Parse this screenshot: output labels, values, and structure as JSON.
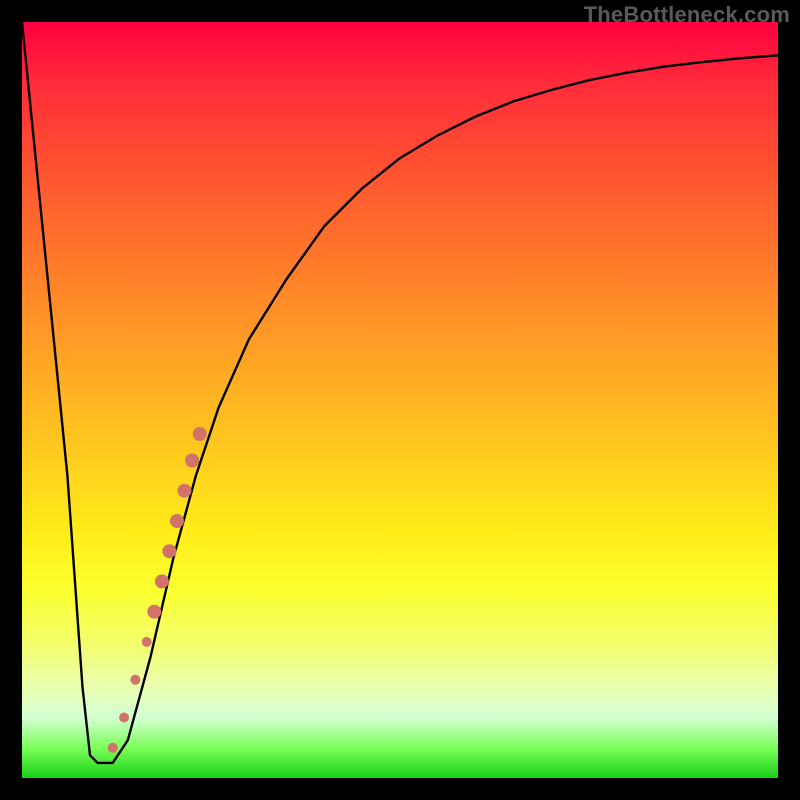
{
  "watermark": "TheBottleneck.com",
  "colors": {
    "frame": "#000000",
    "curve": "#000000",
    "marker": "#d27369",
    "watermark": "#5a5a5a"
  },
  "chart_data": {
    "type": "line",
    "title": "",
    "xlabel": "",
    "ylabel": "",
    "xlim": [
      0,
      100
    ],
    "ylim": [
      0,
      100
    ],
    "grid": false,
    "series": [
      {
        "name": "bottleneck-curve",
        "x": [
          0,
          3,
          6,
          8,
          9,
          10,
          12,
          14,
          17,
          20,
          23,
          26,
          30,
          35,
          40,
          45,
          50,
          55,
          60,
          65,
          70,
          75,
          80,
          85,
          90,
          95,
          100
        ],
        "y": [
          100,
          70,
          40,
          12,
          3,
          2,
          2,
          5,
          16,
          29,
          40,
          49,
          58,
          66,
          73,
          78,
          82,
          85,
          87.5,
          89.5,
          91,
          92.3,
          93.3,
          94.1,
          94.7,
          95.2,
          95.6
        ]
      }
    ],
    "markers": [
      {
        "x": 12.0,
        "y": 4.0,
        "r": 5
      },
      {
        "x": 13.5,
        "y": 8.0,
        "r": 5
      },
      {
        "x": 15.0,
        "y": 13.0,
        "r": 5
      },
      {
        "x": 16.5,
        "y": 18.0,
        "r": 5
      },
      {
        "x": 17.5,
        "y": 22.0,
        "r": 7
      },
      {
        "x": 18.5,
        "y": 26.0,
        "r": 7
      },
      {
        "x": 19.5,
        "y": 30.0,
        "r": 7
      },
      {
        "x": 20.5,
        "y": 34.0,
        "r": 7
      },
      {
        "x": 21.5,
        "y": 38.0,
        "r": 7
      },
      {
        "x": 22.5,
        "y": 42.0,
        "r": 7
      },
      {
        "x": 23.5,
        "y": 45.5,
        "r": 7
      }
    ]
  }
}
